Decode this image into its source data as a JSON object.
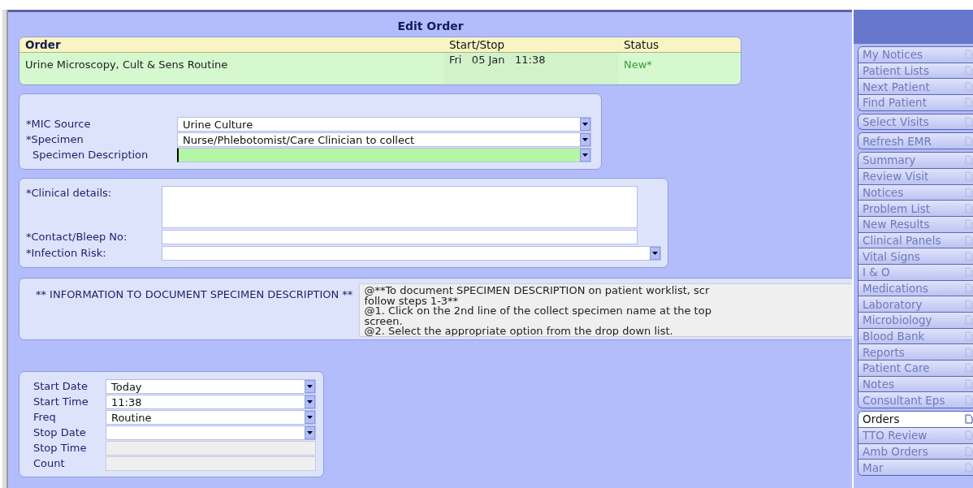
{
  "window": {
    "title": "Edit Order"
  },
  "order": {
    "columns": [
      "Order",
      "Start/Stop",
      "Status"
    ],
    "row": {
      "order": "Urine Microscopy, Cult & Sens Routine",
      "start_stop": "Fri   05 Jan   11:38",
      "status": "New*"
    }
  },
  "specimen_fields": [
    {
      "label": "*MIC Source",
      "kind": "dropdown",
      "value": "Urine Culture",
      "focused": false
    },
    {
      "label": "*Specimen",
      "kind": "dropdown",
      "value": "Nurse/Phlebotomist/Care Clinician to collect",
      "focused": false
    },
    {
      "label": "Specimen Description",
      "kind": "dropdown",
      "focused": true
    }
  ],
  "clinical_fields": [
    {
      "label": "*Clinical details:",
      "kind": "textarea"
    },
    {
      "label": "*Contact/Bleep No:",
      "kind": "text"
    },
    {
      "label": "*Infection Risk:",
      "kind": "dropdown"
    }
  ],
  "info": {
    "heading": "** INFORMATION  TO DOCUMENT SPECIMEN DESCRIPTION **",
    "lines": [
      "@**To document SPECIMEN DESCRIPTION on patient worklist, scr",
      "follow steps 1-3**",
      "@1. Click on the 2nd line of the collect specimen name at the top",
      "screen.",
      "@2. Select the appropriate option from the drop down list."
    ]
  },
  "schedule_fields": [
    {
      "label": "Start Date",
      "kind": "dropdown",
      "value": "Today",
      "disabled": false
    },
    {
      "label": "Start Time",
      "kind": "dropdown",
      "value": "11:38",
      "disabled": false
    },
    {
      "label": "Freq",
      "kind": "dropdown",
      "value": "Routine",
      "disabled": false
    },
    {
      "label": "Stop Date",
      "kind": "dropdown",
      "disabled": false
    },
    {
      "label": "Stop Time",
      "kind": "text",
      "disabled": true
    },
    {
      "label": "Count",
      "kind": "text",
      "disabled": true
    }
  ],
  "sidebar": {
    "groups": [
      [
        {
          "label": "My Notices",
          "selected": false,
          "disabled": true
        },
        {
          "label": "Patient Lists",
          "selected": false,
          "disabled": true
        },
        {
          "label": "Next Patient",
          "selected": false,
          "disabled": true
        },
        {
          "label": "Find Patient",
          "selected": false,
          "disabled": true
        }
      ],
      [
        {
          "label": "Select Visits",
          "selected": false,
          "disabled": true
        }
      ],
      [
        {
          "label": "Refresh EMR",
          "selected": false,
          "disabled": true
        }
      ],
      [
        {
          "label": "Summary",
          "selected": false,
          "disabled": true
        },
        {
          "label": "Review Visit",
          "selected": false,
          "disabled": true
        },
        {
          "label": "Notices",
          "selected": false,
          "disabled": true
        },
        {
          "label": "Problem List",
          "selected": false,
          "disabled": true
        },
        {
          "label": "New Results",
          "selected": false,
          "disabled": true
        },
        {
          "label": "Clinical Panels",
          "selected": false,
          "disabled": true
        },
        {
          "label": "Vital Signs",
          "selected": false,
          "disabled": true
        },
        {
          "label": "I & O",
          "selected": false,
          "disabled": true
        },
        {
          "label": "Medications",
          "selected": false,
          "disabled": true
        },
        {
          "label": "Laboratory",
          "selected": false,
          "disabled": true
        },
        {
          "label": "Microbiology",
          "selected": false,
          "disabled": true
        },
        {
          "label": "Blood Bank",
          "selected": false,
          "disabled": true
        },
        {
          "label": "Reports",
          "selected": false,
          "disabled": true
        },
        {
          "label": "Patient Care",
          "selected": false,
          "disabled": true
        },
        {
          "label": "Notes",
          "selected": false,
          "disabled": true
        },
        {
          "label": "Consultant Eps",
          "selected": false,
          "disabled": true
        }
      ],
      [
        {
          "label": "Orders",
          "selected": true,
          "disabled": false
        },
        {
          "label": "TTO Review",
          "selected": false,
          "disabled": true
        },
        {
          "label": "Amb Orders",
          "selected": false,
          "disabled": true
        },
        {
          "label": "Mar",
          "selected": false,
          "disabled": true
        }
      ]
    ]
  }
}
